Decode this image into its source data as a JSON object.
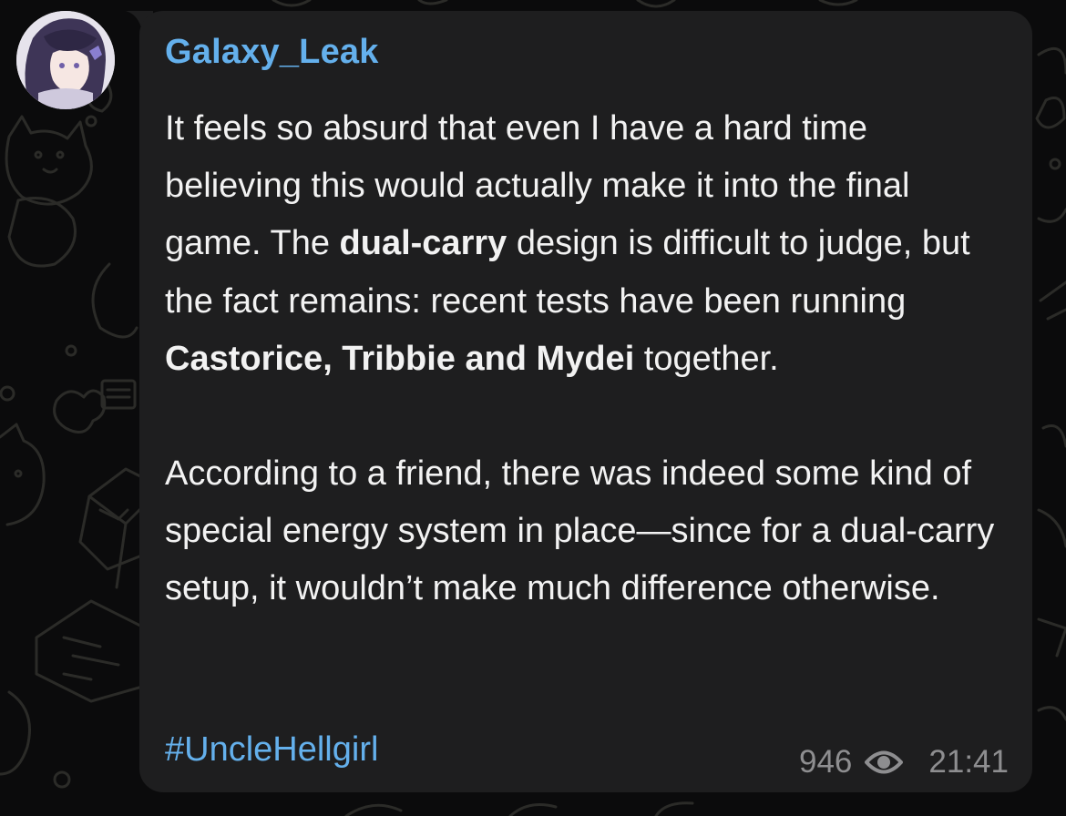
{
  "message": {
    "author": "Galaxy_Leak",
    "paragraph1": {
      "t1": "It feels so absurd that even I have a hard time believing this would actually make it into the final game. The ",
      "b1": "dual-carry",
      "t2": " design is difficult to judge, but the fact remains: recent tests have been running ",
      "b2": "Castorice, Tribbie and Mydei",
      "t3": " together."
    },
    "paragraph2": "According to a friend, there was indeed some kind of special energy system in place—since for a dual-carry setup, it wouldn’t make much difference otherwise.",
    "hashtag": "#UncleHellgirl",
    "views": "946",
    "time": "21:41"
  },
  "icons": {
    "views": "eye-icon"
  },
  "colors": {
    "background": "#0b0b0c",
    "bubble": "#1e1e1f",
    "accent": "#64b0ec",
    "text": "#f2f2f2",
    "meta": "#8e8e90"
  }
}
